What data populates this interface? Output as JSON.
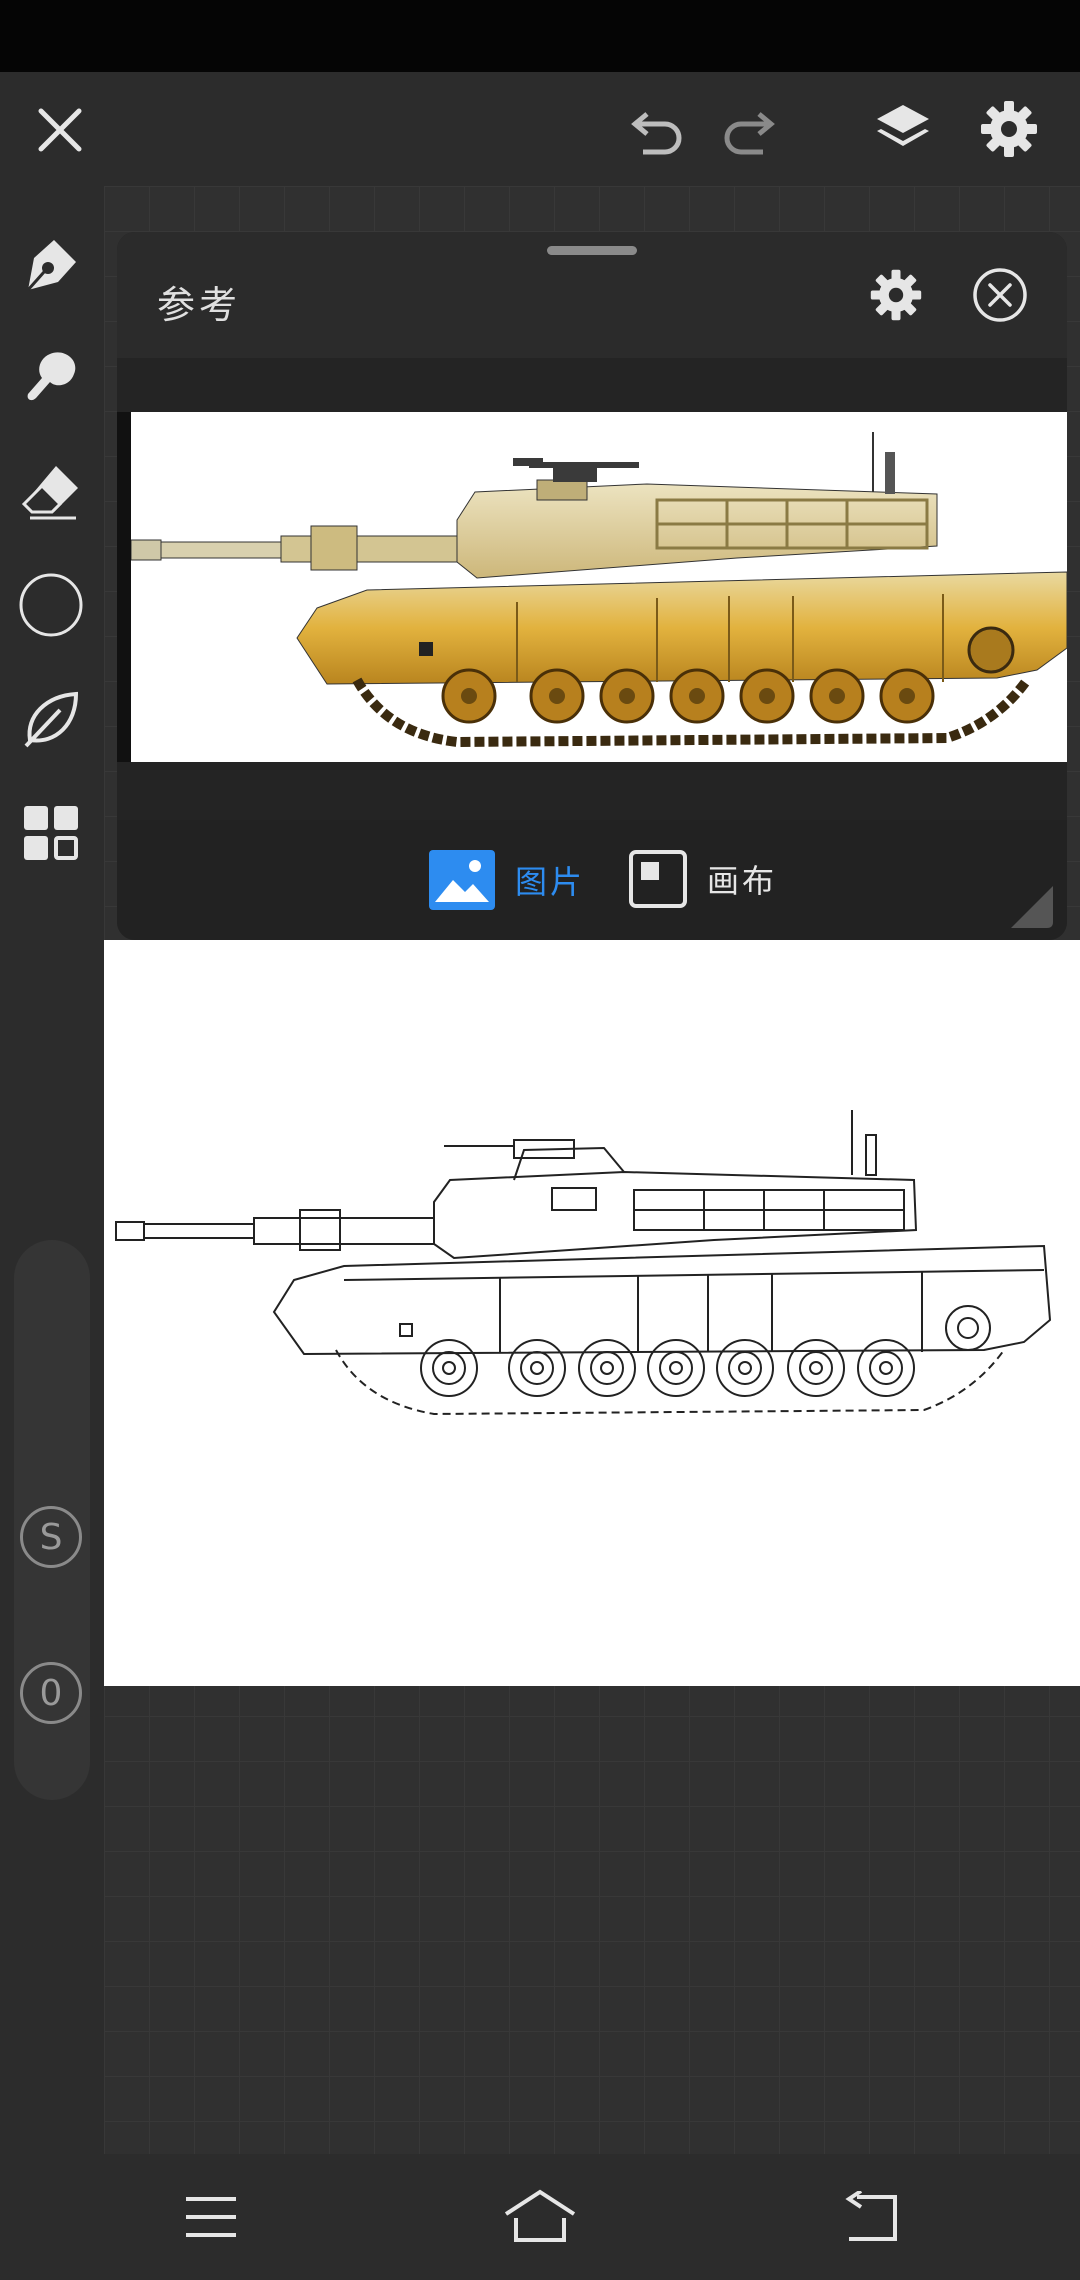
{
  "panel": {
    "title": "参考",
    "tabs": [
      {
        "label": "图片",
        "active": true
      },
      {
        "label": "画布",
        "active": false
      }
    ]
  },
  "sidebar": {
    "tools": [
      "pen-icon",
      "brush-icon",
      "eraser-icon",
      "shape-circle-icon",
      "leaf-icon",
      "grid-icon"
    ],
    "slider_size_label": "S",
    "slider_opacity_label": "0"
  },
  "colors": {
    "accent": "#2d8cf0",
    "toolbar": "#2c2c2c",
    "panel": "#242424"
  }
}
